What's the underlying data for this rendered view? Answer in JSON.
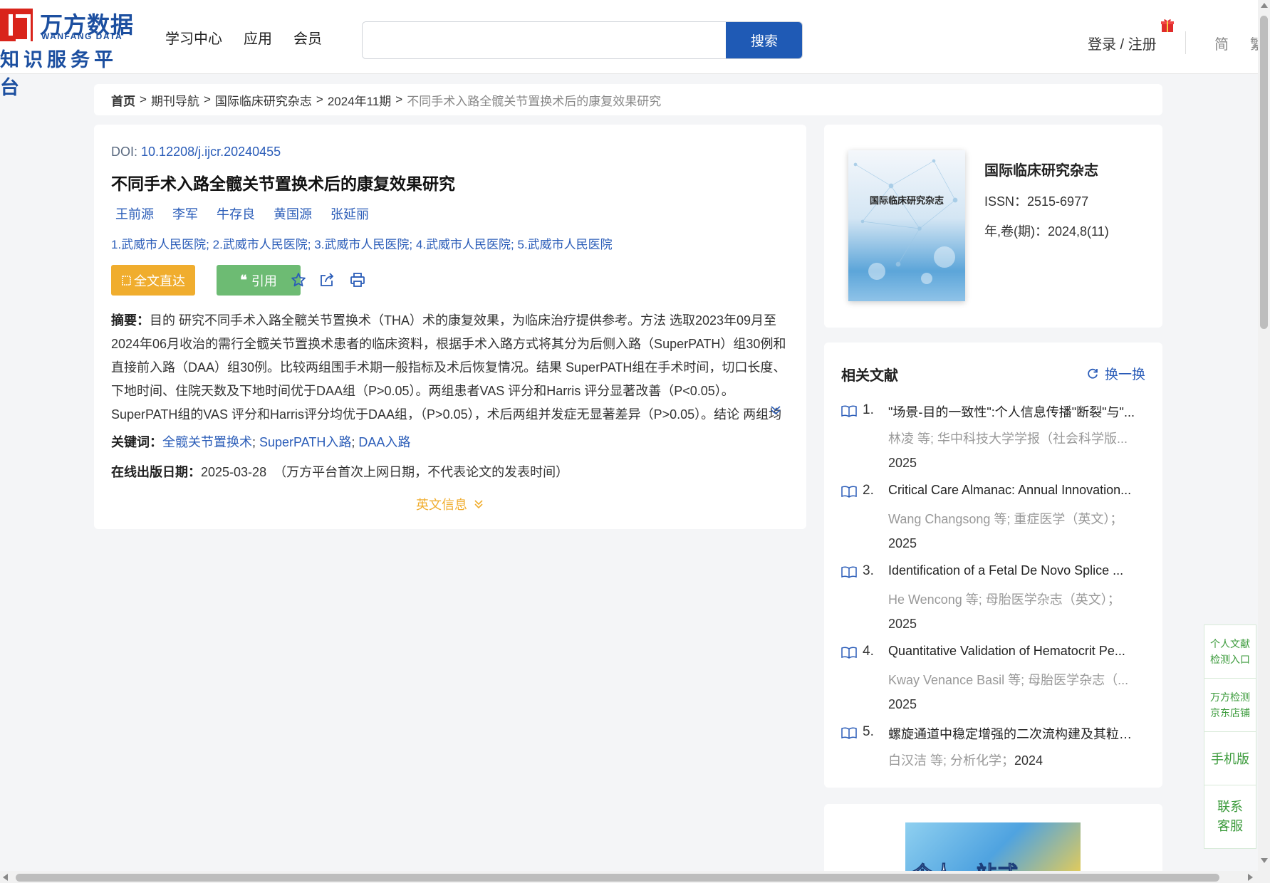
{
  "header": {
    "logo_cn": "万方数据",
    "logo_en": "WANFANG DATA",
    "logo_sub": "知识服务平台",
    "nav": [
      "学习中心",
      "应用",
      "会员"
    ],
    "search": {
      "value": "",
      "placeholder": "",
      "button": "搜索"
    },
    "login": "登录 / 注册",
    "lang_simp": "简",
    "lang_trad": "繁"
  },
  "breadcrumb": {
    "home": "首页",
    "items": [
      "期刊导航",
      "国际临床研究杂志",
      "2024年11期"
    ],
    "current": "不同手术入路全髋关节置换术后的康复效果研究",
    "separator": ">"
  },
  "article": {
    "doi_label": "DOI:",
    "doi": "10.12208/j.ijcr.20240455",
    "title": "不同手术入路全髋关节置换术后的康复效果研究",
    "authors": [
      "王前源",
      "李军",
      "牛存良",
      "黄国源",
      "张延丽"
    ],
    "affiliations": "1.武威市人民医院; 2.武威市人民医院; 3.武威市人民医院; 4.武威市人民医院; 5.武威市人民医院",
    "btn_fulltext": "全文直达",
    "btn_cite": "引用",
    "abstract_label": "摘要：",
    "abstract": "目的 研究不同手术入路全髋关节置换术（THA）术的康复效果，为临床治疗提供参考。方法 选取2023年09月至2024年06月收治的需行全髋关节置换术患者的临床资料，根据手术入路方式将其分为后侧入路（SuperPATH）组30例和直接前入路（DAA）组30例。比较两组围手术期一般指标及术后恢复情况。结果 SuperPATH组在手术时间，切口长度、下地时间、住院天数及下地时间优于DAA组（P>0.05）。两组患者VAS 评分和Harris 评分显著改善（P<0.05）。SuperPATH组的VAS 评分和Harris评分均优于DAA组，（P>0.05），术后两组并发症无显著差异（P>0.05）。结论 两组均可改善...",
    "keywords_label": "关键词：",
    "keywords": [
      "全髋关节置换术",
      "SuperPATH入路",
      "DAA入路"
    ],
    "pubdate_label": "在线出版日期：",
    "pubdate": "2025-03-28",
    "pubdate_note": "（万方平台首次上网日期，不代表论文的发表时间）",
    "english_info": "英文信息"
  },
  "journal": {
    "name": "国际临床研究杂志",
    "cover_title": "国际临床研究杂志",
    "issn": "ISSN：2515-6977",
    "volume": "年,卷(期)：2024,8(11)"
  },
  "related": {
    "title": "相关文献",
    "refresh": "换一换",
    "items": [
      {
        "num": "1.",
        "title": "\"场景-目的一致性\":个人信息传播\"断裂\"与\"...",
        "meta": "林凌  等;  华中科技大学学报（社会科学版...",
        "year": "2025"
      },
      {
        "num": "2.",
        "title": "Critical Care Almanac: Annual Innovation...",
        "meta": "Wang Changsong  等;  重症医学（英文）；",
        "year": "2025"
      },
      {
        "num": "3.",
        "title": "Identification of a Fetal De Novo Splice ...",
        "meta": "He Wencong  等;  母胎医学杂志（英文）；",
        "year": "2025"
      },
      {
        "num": "4.",
        "title": "Quantitative Validation of Hematocrit Pe...",
        "meta": "Kway Venance Basil  等;  母胎医学杂志（...",
        "year": "2025"
      },
      {
        "num": "5.",
        "title": "螺旋通道中稳定增强的二次流构建及其粒子...",
        "meta": "白汉洁  等;  分析化学；",
        "year": "2024"
      }
    ]
  },
  "ad": {
    "text": "个人一站式"
  },
  "float": {
    "items": [
      "个人文献检测入口",
      "万方检测京东店铺",
      "手机版",
      "联系客服"
    ]
  },
  "colors": {
    "brand_blue": "#1f5ab5",
    "link_blue": "#2a5cb8",
    "orange": "#f0ad2e",
    "green": "#6dbb73",
    "logo_red": "#d9241b"
  }
}
